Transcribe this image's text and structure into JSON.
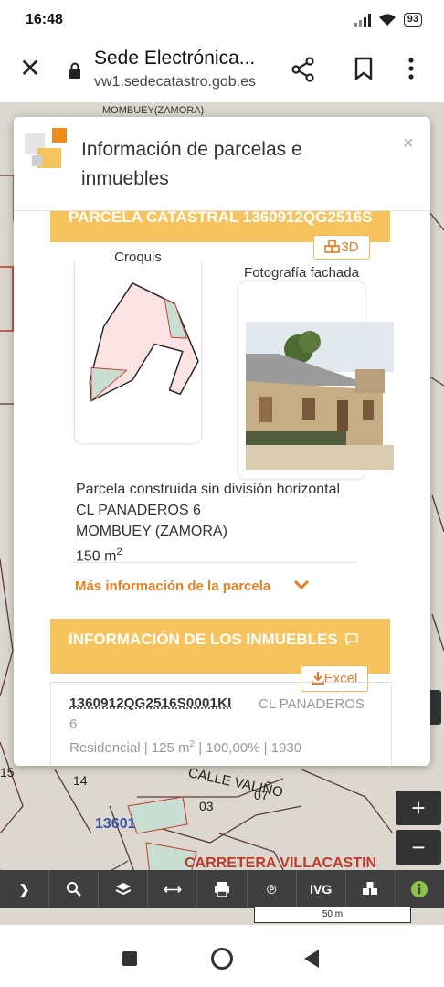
{
  "status": {
    "time": "16:48",
    "battery": "93"
  },
  "browser": {
    "title": "Sede Electrónica...",
    "url": "vw1.sedecatastro.gob.es"
  },
  "map": {
    "top_label": "MOMBUEY(ZAMORA)",
    "street1": "CALLE VALIÑO",
    "street2": "CARRETERA VILLACASTIN",
    "parcel": "13601",
    "nums": [
      "15",
      "14",
      "03",
      "07"
    ],
    "scale": "50 m",
    "zoom_in": "+",
    "zoom_out": "−",
    "toolbar_text_ivg": "IVG"
  },
  "modal": {
    "title": "Información de parcelas e inmuebles",
    "close": "×",
    "banner_parcela": "PARCELA CATASTRAL 1360912QG2516S",
    "btn_3d": "3D",
    "croquis_label": "Croquis",
    "foto_label": "Fotografía fachada",
    "parcel_lines": [
      "Parcela construida sin división horizontal",
      "CL PANADEROS 6",
      "MOMBUEY (ZAMORA)"
    ],
    "area_value": "150 m",
    "area_sup": "2",
    "more_info": "Más información de la parcela",
    "banner_inmuebles": "INFORMACIÓN DE LOS INMUEBLES",
    "excel_label": "Excel",
    "inmueble": {
      "ref": "1360912QG2516S0001KI",
      "addr1": "CL PANADEROS",
      "addr2": "6",
      "uso": "Residencial",
      "sup": "125 m",
      "sup_sup": "2",
      "pct": "100,00%",
      "year": "1930"
    }
  }
}
